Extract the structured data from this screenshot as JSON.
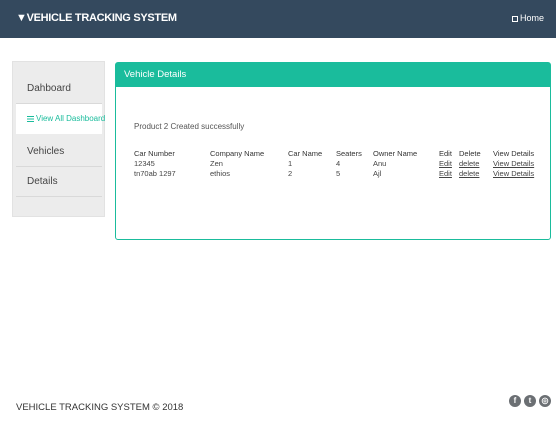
{
  "header": {
    "brand": "▼VEHICLE TRACKING SYSTEM",
    "home_label": "Home"
  },
  "sidebar": {
    "items": [
      {
        "label": "Dahboard"
      },
      {
        "label": "View All Dashboard"
      },
      {
        "label": "Vehicles"
      },
      {
        "label": "Details"
      }
    ]
  },
  "panel": {
    "title": "Vehicle Details",
    "message": "Product 2 Created successfully"
  },
  "table": {
    "headers": [
      "Car Number",
      "Company Name",
      "Car Name",
      "Seaters",
      "Owner Name",
      "Edit",
      "Delete",
      "View Details"
    ],
    "rows": [
      {
        "car_number": "12345",
        "company": "Zen",
        "car_name": "1",
        "seaters": "4",
        "owner": "Anu",
        "edit": "Edit",
        "delete": "delete",
        "view": "View Details"
      },
      {
        "car_number": "tn70ab 1297",
        "company": "ethios",
        "car_name": "2",
        "seaters": "5",
        "owner": "Ajl",
        "edit": "Edit",
        "delete": "delete",
        "view": "View Details"
      }
    ]
  },
  "footer": {
    "copyright": "VEHICLE TRACKING SYSTEM © 2018",
    "social": [
      {
        "icon": "facebook-icon",
        "glyph": "f"
      },
      {
        "icon": "twitter-icon",
        "glyph": "t"
      },
      {
        "icon": "instagram-icon",
        "glyph": "◎"
      }
    ]
  },
  "colors": {
    "topbar": "#34495e",
    "accent": "#1abc9c",
    "sidebar_bg": "#ececec"
  }
}
